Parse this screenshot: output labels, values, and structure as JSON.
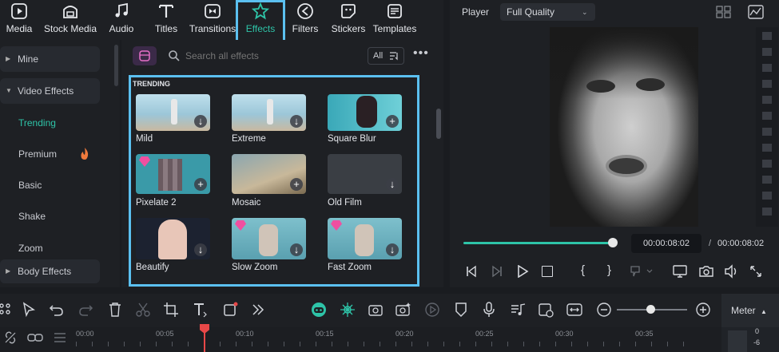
{
  "toolbar": {
    "tabs": [
      {
        "label": "Media",
        "icon": "media-icon"
      },
      {
        "label": "Stock Media",
        "icon": "stock-media-icon"
      },
      {
        "label": "Audio",
        "icon": "music-note-icon"
      },
      {
        "label": "Titles",
        "icon": "titles-icon"
      },
      {
        "label": "Transitions",
        "icon": "transitions-icon"
      },
      {
        "label": "Effects",
        "icon": "effects-star-icon"
      },
      {
        "label": "Filters",
        "icon": "filters-icon"
      },
      {
        "label": "Stickers",
        "icon": "stickers-icon"
      },
      {
        "label": "Templates",
        "icon": "templates-icon"
      }
    ],
    "active_tab": "Effects"
  },
  "sidebar": {
    "mine": "Mine",
    "video_effects": "Video Effects",
    "items": [
      "Trending",
      "Premium",
      "Basic",
      "Shake",
      "Zoom"
    ],
    "body_effects": "Body Effects"
  },
  "search": {
    "placeholder": "Search all effects",
    "filter_label": "All"
  },
  "grid": {
    "section_title": "TRENDING",
    "cards": [
      "Mild",
      "Extreme",
      "Square Blur",
      "Pixelate 2",
      "Mosaic",
      "Old Film",
      "Beautify",
      "Slow Zoom",
      "Fast Zoom"
    ]
  },
  "player": {
    "label": "Player",
    "quality": "Full Quality",
    "current_time": "00:00:08:02",
    "separator": "/",
    "total_time": "00:00:08:02",
    "progress": 1.0
  },
  "timeline": {
    "meter_label": "Meter",
    "ruler": [
      "00:00",
      "00:05",
      "00:10",
      "00:15",
      "00:20",
      "00:25",
      "00:30",
      "00:35"
    ],
    "meter_scale": [
      "0",
      "-6"
    ]
  },
  "colors": {
    "accent": "#2ec4a8",
    "highlight": "#5bc0f0",
    "premium": "#f04fa0"
  }
}
